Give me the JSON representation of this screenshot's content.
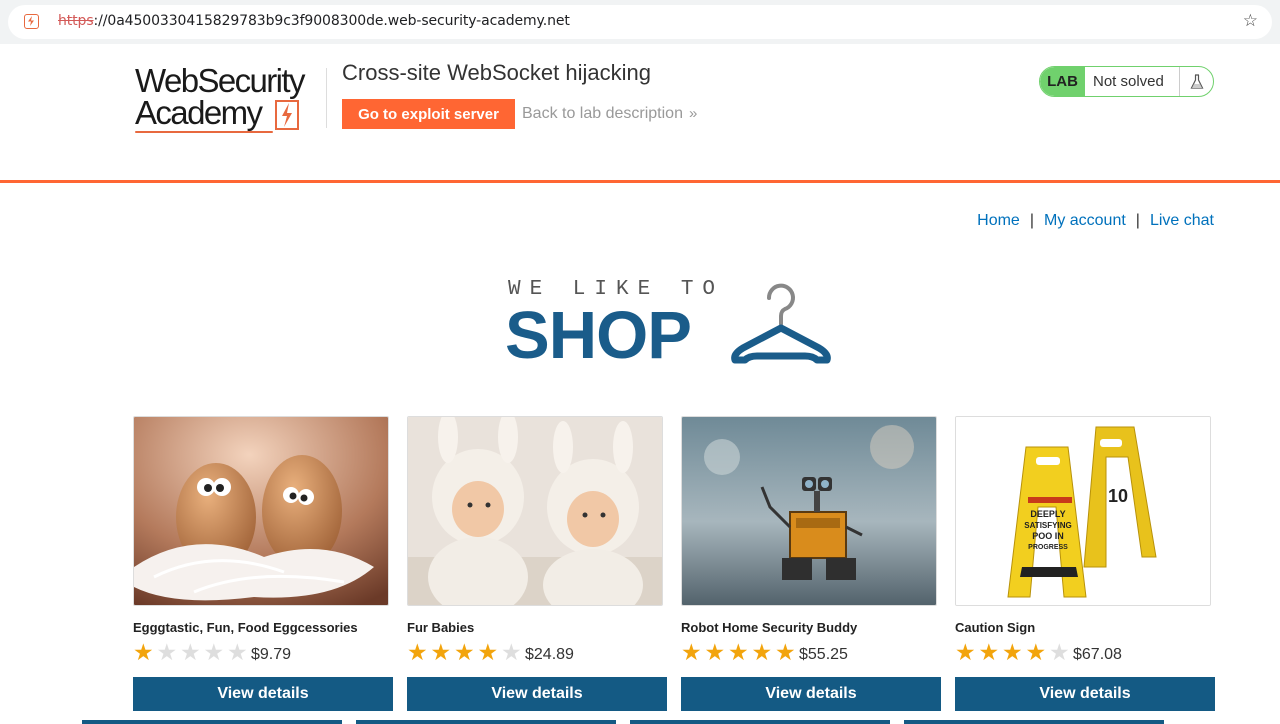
{
  "browser": {
    "url_scheme": "https",
    "url_rest": "://0a4500330415829783b9c3f9008300de.web-security-academy.net"
  },
  "header": {
    "logo_line1": "WebSecurity",
    "logo_line2": "Academy",
    "lab_title": "Cross-site WebSocket hijacking",
    "exploit_button": "Go to exploit server",
    "back_link": "Back to lab description",
    "status_label": "LAB",
    "status_text": "Not solved"
  },
  "nav": {
    "items": [
      "Home",
      "My account",
      "Live chat"
    ],
    "separator": "|"
  },
  "banner": {
    "small_text": "WE LIKE TO",
    "big_text": "SHOP"
  },
  "products": [
    {
      "name": "Egggtastic, Fun, Food Eggcessories",
      "rating": 1,
      "price": "$9.79",
      "button": "View details"
    },
    {
      "name": "Fur Babies",
      "rating": 4,
      "price": "$24.89",
      "button": "View details"
    },
    {
      "name": "Robot Home Security Buddy",
      "rating": 5,
      "price": "$55.25",
      "button": "View details"
    },
    {
      "name": "Caution Sign",
      "rating": 4,
      "price": "$67.08",
      "button": "View details"
    }
  ],
  "colors": {
    "accent_orange": "#ff6633",
    "lab_green": "#70d16d",
    "brand_blue": "#1a5c8a",
    "button_blue": "#145a84",
    "link_blue": "#0071bc",
    "star_gold": "#f2a40c"
  },
  "sign_text": {
    "front": "DEEPLY SATISFYING POO IN PROGRESS",
    "back": "10"
  }
}
